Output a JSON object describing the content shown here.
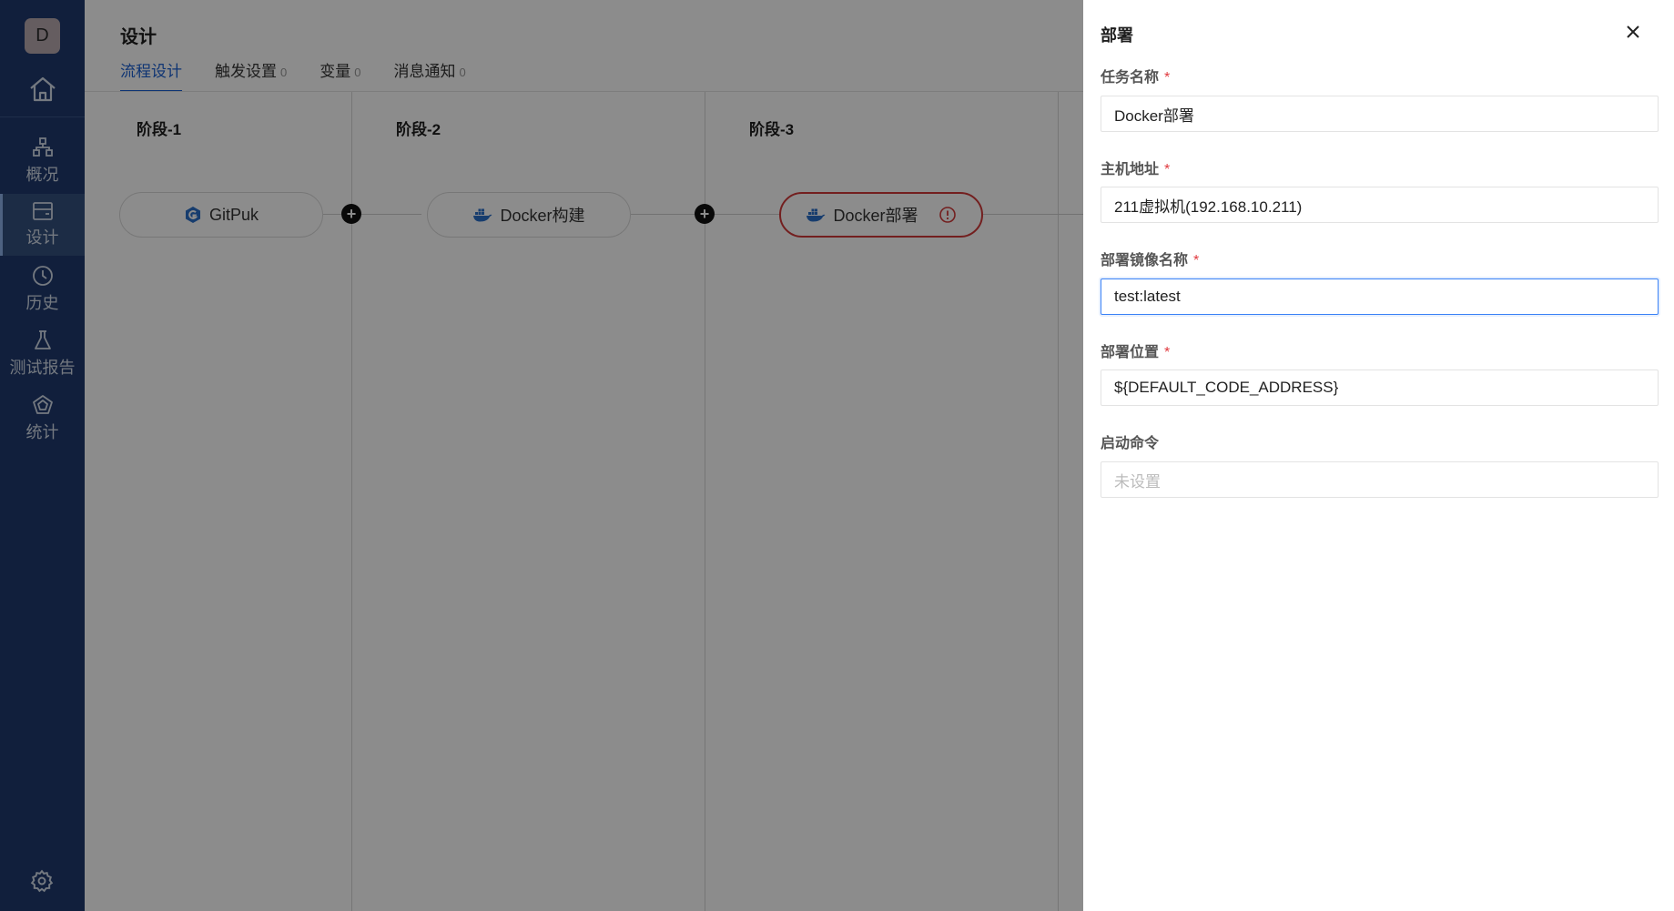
{
  "sidebar": {
    "avatar": "D",
    "items": [
      {
        "label": "概况",
        "icon": "overview-icon"
      },
      {
        "label": "设计",
        "icon": "design-icon",
        "active": true
      },
      {
        "label": "历史",
        "icon": "history-icon"
      },
      {
        "label": "测试报告",
        "icon": "test-report-icon"
      },
      {
        "label": "统计",
        "icon": "statistics-icon"
      }
    ]
  },
  "header": {
    "title": "设计",
    "tabs": [
      {
        "label": "流程设计",
        "count": ""
      },
      {
        "label": "触发设置",
        "count": "0"
      },
      {
        "label": "变量",
        "count": "0"
      },
      {
        "label": "消息通知",
        "count": "0"
      }
    ]
  },
  "pipeline": {
    "stages": [
      {
        "title": "阶段-1",
        "job": "GitPuk"
      },
      {
        "title": "阶段-2",
        "job": "Docker构建"
      },
      {
        "title": "阶段-3",
        "job": "Docker部署"
      }
    ]
  },
  "drawer": {
    "title": "部署",
    "fields": [
      {
        "label": "任务名称",
        "required": "*",
        "value": "Docker部署"
      },
      {
        "label": "主机地址",
        "required": "*",
        "value": "211虚拟机(192.168.10.211)"
      },
      {
        "label": "部署镜像名称",
        "required": "*",
        "value": "test:latest"
      },
      {
        "label": "部署位置",
        "required": "*",
        "value": "${DEFAULT_CODE_ADDRESS}"
      },
      {
        "label": "启动命令",
        "required": "",
        "value": "未设置"
      }
    ]
  },
  "colors": {
    "sidebar": "#1f3a6e",
    "accent": "#1a5fd1",
    "error": "#d23a3a",
    "docker": "#2a6fc9"
  }
}
